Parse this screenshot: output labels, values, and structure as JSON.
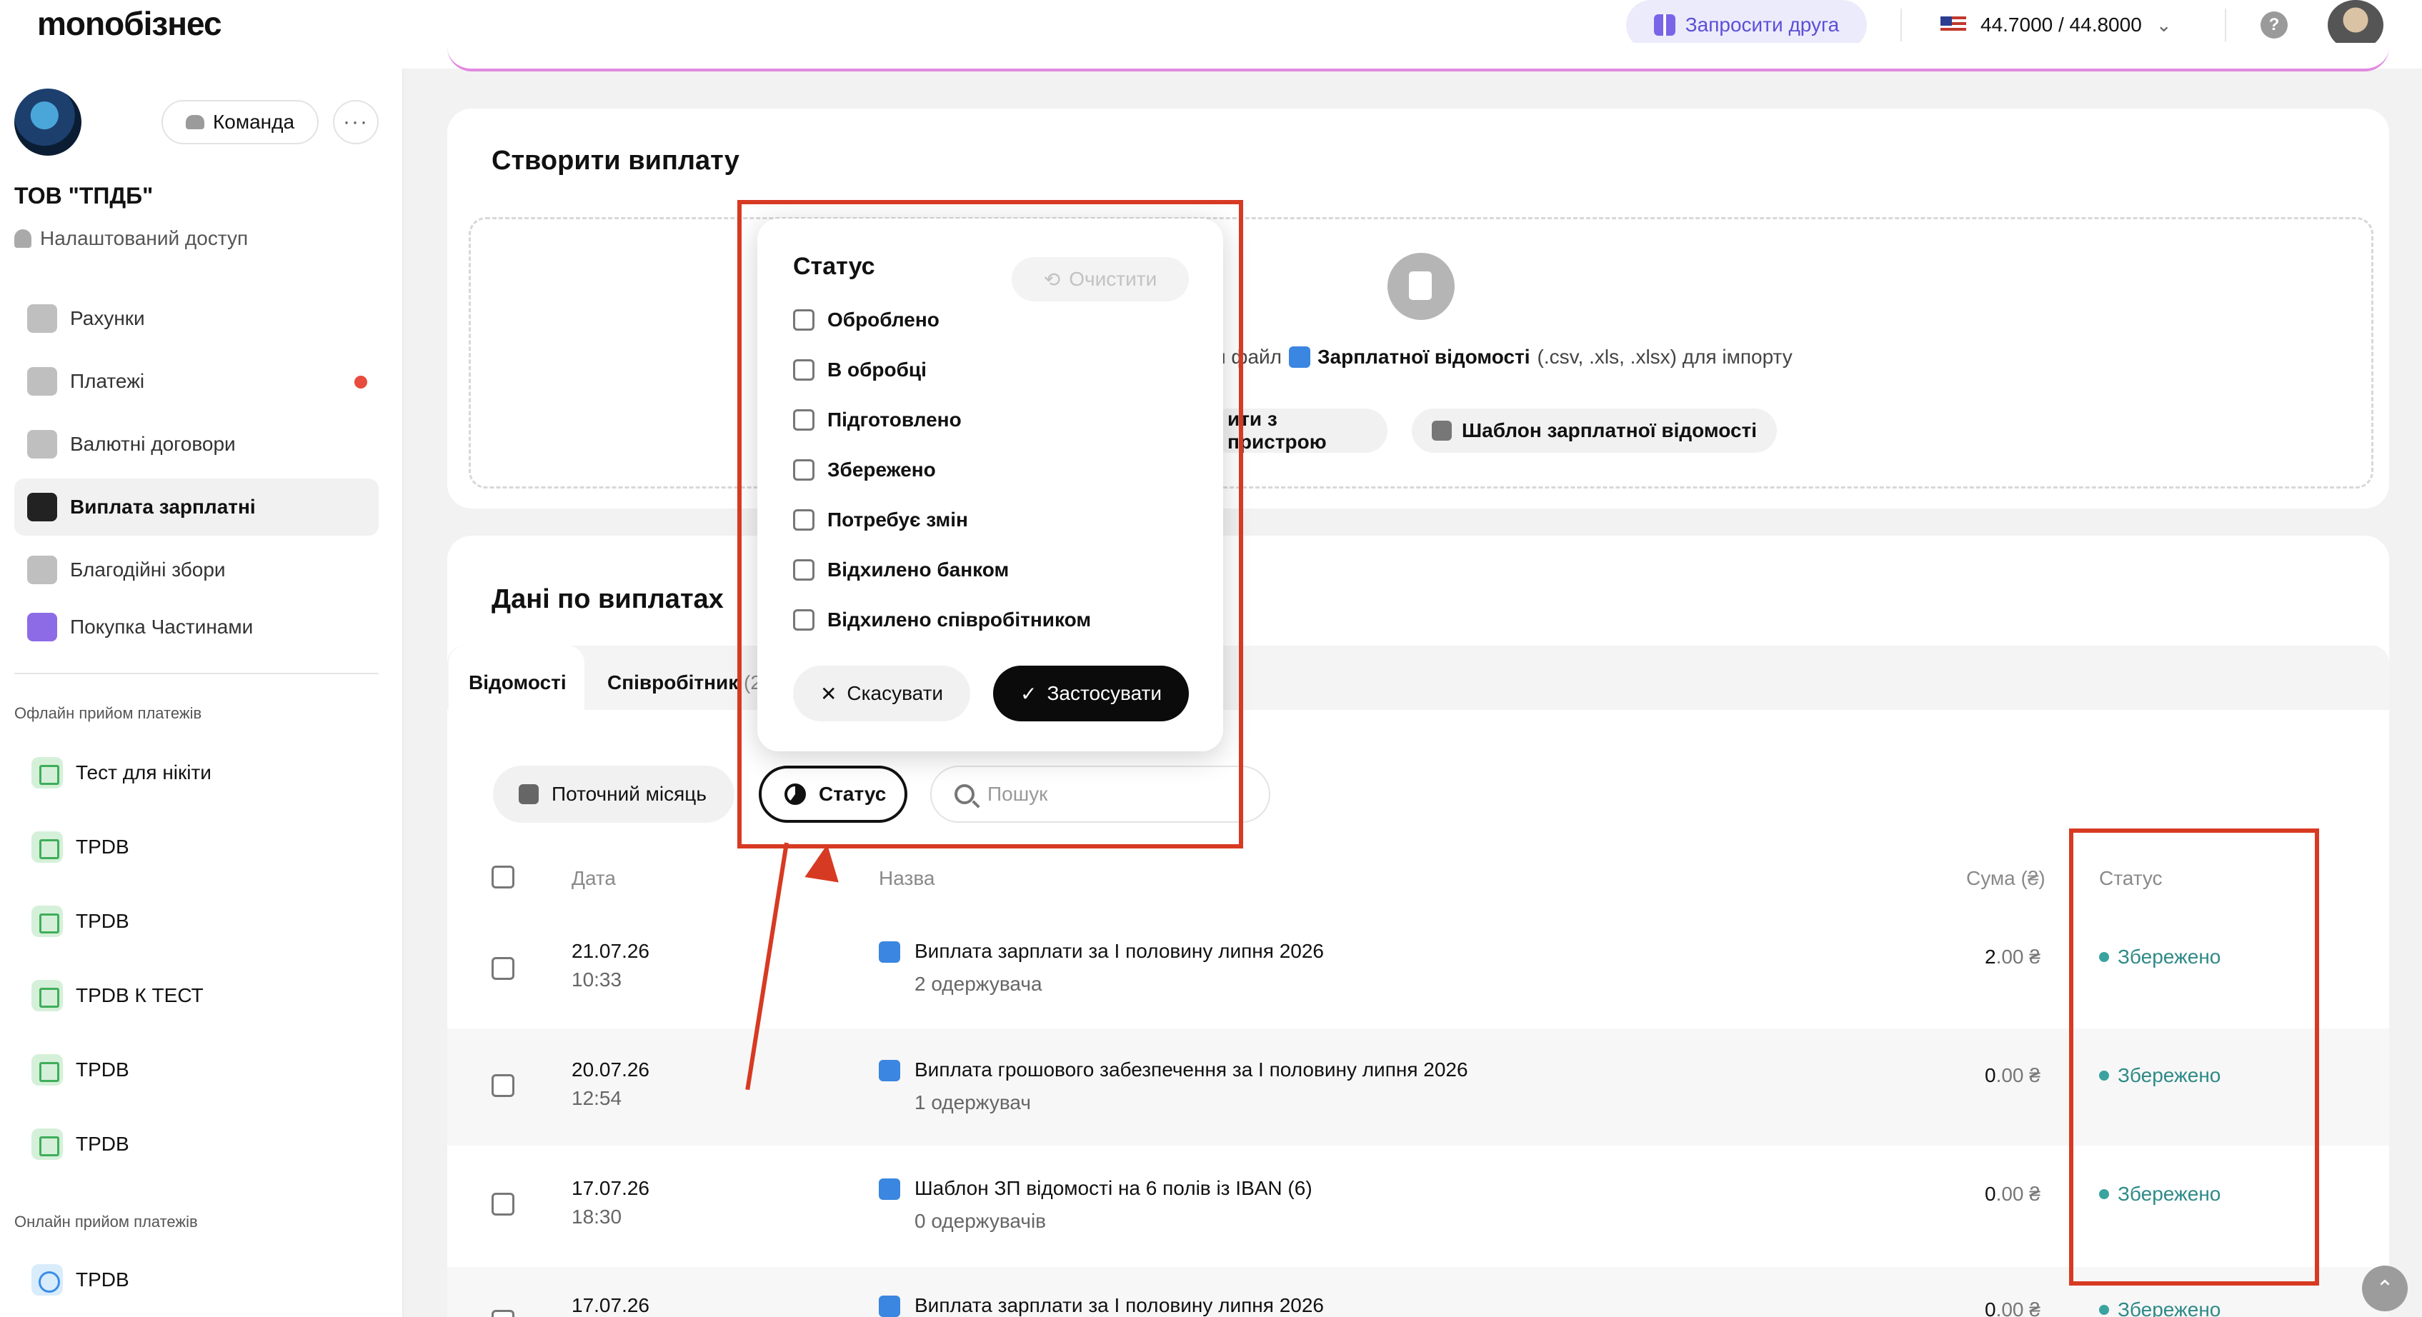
{
  "topbar": {
    "logo": "monoбізнес",
    "invite_label": "Запросити друга",
    "rates": "44.7000 / 44.8000",
    "help_glyph": "?"
  },
  "sidebar": {
    "team_label": "Команда",
    "more_glyph": "···",
    "company_name": "ТОВ \"ТПДБ\"",
    "access_label": "Налаштований доступ",
    "nav": [
      {
        "label": "Рахунки",
        "icon": "piggy-bank-icon"
      },
      {
        "label": "Платежі",
        "icon": "payments-icon"
      },
      {
        "label": "Валютні договори",
        "icon": "currency-contract-icon"
      },
      {
        "label": "Виплата зарплатні",
        "icon": "salary-icon"
      },
      {
        "label": "Благодійні збори",
        "icon": "charity-icon"
      },
      {
        "label": "Покупка Частинами",
        "icon": "paw-icon"
      }
    ],
    "offline_label": "Офлайн прийом платежів",
    "offline_items": [
      "Тест для нікіти",
      "TPDB",
      "TPDB",
      "TPDB К ТЕСТ",
      "TPDB",
      "TPDB"
    ],
    "online_label": "Онлайн прийом платежів",
    "online_items": [
      "TPDB"
    ]
  },
  "create": {
    "title": "Створити виплату",
    "drop_prefix": "и файл",
    "drop_doc": "Зарплатної відомості",
    "drop_suffix": "(.csv, .xls, .xlsx) для імпорту",
    "device_btn": "ити з пристрою",
    "template_btn": "Шаблон зарплатної відомості"
  },
  "payouts": {
    "title": "Дані по виплатах",
    "tabs": [
      "Відомості",
      "Співробітник"
    ],
    "tab2_suffix": "(2",
    "filter_month": "Поточний місяць",
    "filter_status": "Статус",
    "search_placeholder": "Пошук",
    "columns": {
      "date": "Дата",
      "name": "Назва",
      "sum": "Сума (₴)",
      "status": "Статус"
    },
    "rows": [
      {
        "date": "21.07.26",
        "time": "10:33",
        "name": "Виплата зарплати за І половину липня 2026",
        "recipients": "2 одержувача",
        "amount_int": "2",
        "amount_dec": ".00 ₴",
        "status": "Збережено"
      },
      {
        "date": "20.07.26",
        "time": "12:54",
        "name": "Виплата грошового забезпечення за І половину липня 2026",
        "recipients": "1 одержувач",
        "amount_int": "0",
        "amount_dec": ".00 ₴",
        "status": "Збережено"
      },
      {
        "date": "17.07.26",
        "time": "18:30",
        "name": "Шаблон ЗП відомості на 6 полів із IBAN (6)",
        "recipients": "0 одержувачів",
        "amount_int": "0",
        "amount_dec": ".00 ₴",
        "status": "Збережено"
      },
      {
        "date": "17.07.26",
        "time": "",
        "name": "Виплата зарплати за І половину липня 2026",
        "recipients": "",
        "amount_int": "0",
        "amount_dec": ".00 ₴",
        "status": "Збережено"
      }
    ]
  },
  "status_popup": {
    "title": "Статус",
    "clear_label": "Очистити",
    "options": [
      "Оброблено",
      "В обробці",
      "Підготовлено",
      "Збережено",
      "Потребує змін",
      "Відхилено банком",
      "Відхилено співробітником"
    ],
    "cancel_label": "Скасувати",
    "apply_label": "Застосувати"
  },
  "colors": {
    "accent": "#5b4fd6",
    "status_saved": "#2e8a87",
    "annotation": "#d73a22",
    "alert_dot": "#e74c3c"
  },
  "icons": {
    "scroll_top": "⌃",
    "check": "✓",
    "close": "✕",
    "refresh": "⟲"
  }
}
